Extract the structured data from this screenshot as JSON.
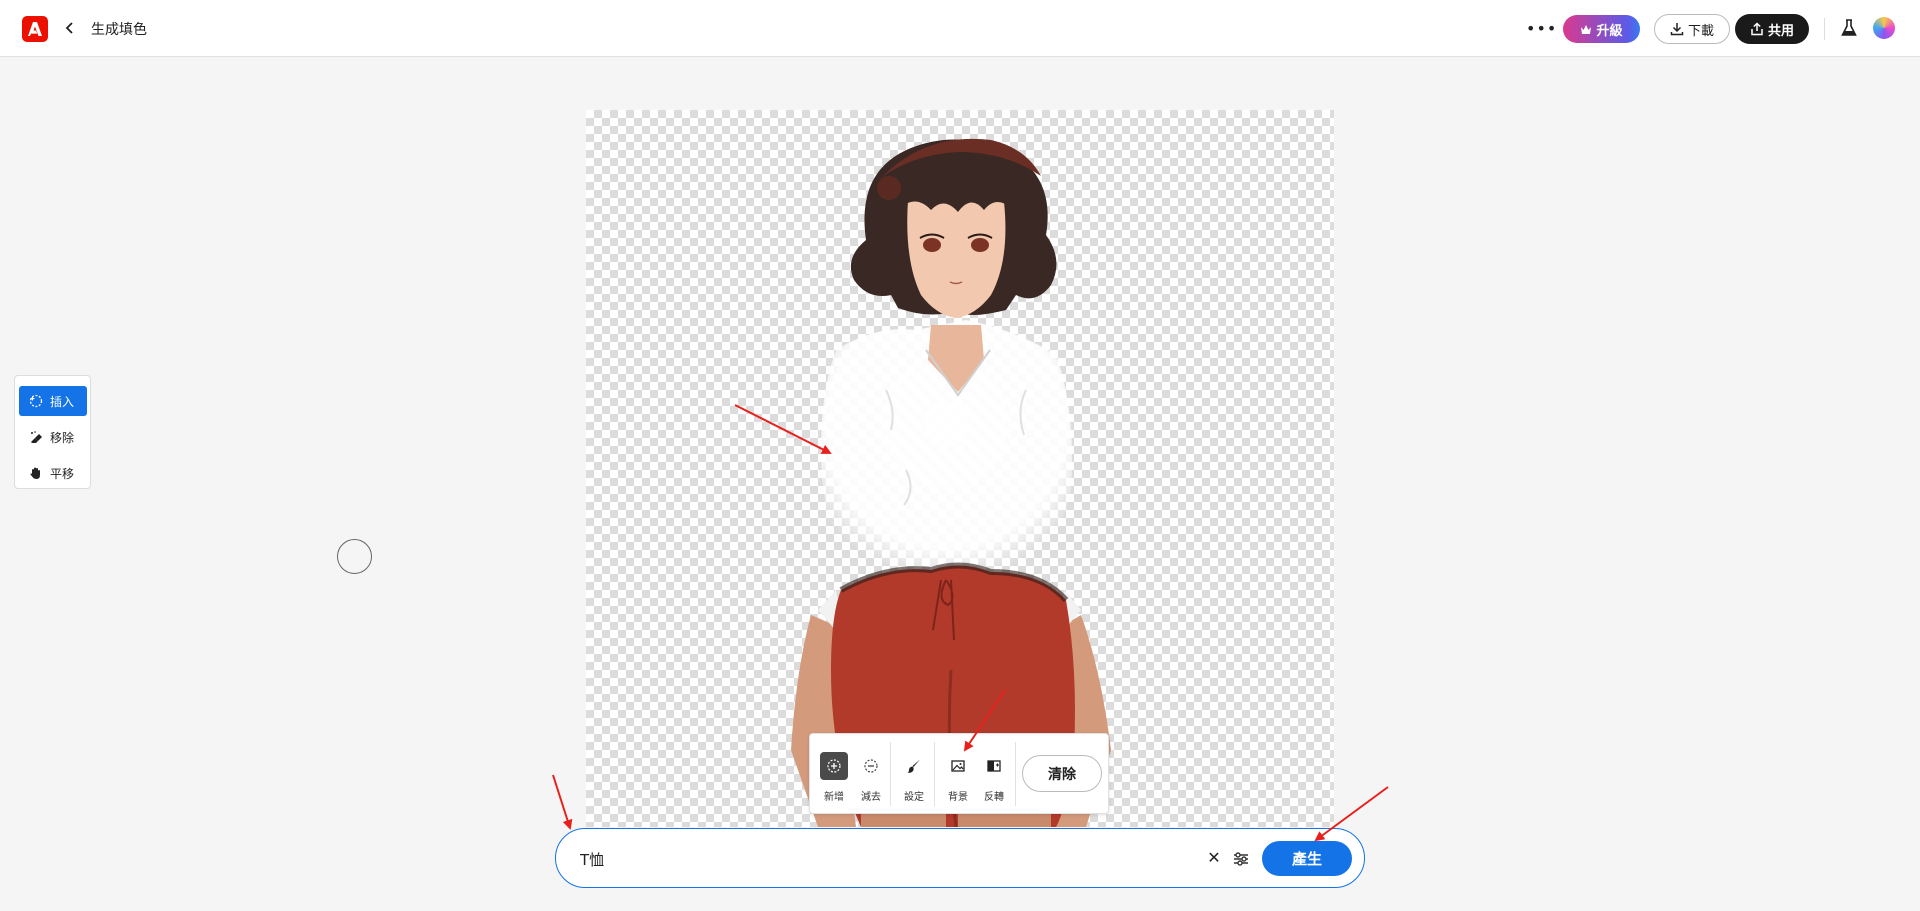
{
  "header": {
    "title": "生成填色",
    "upgrade_label": "升級",
    "download_label": "下載",
    "share_label": "共用"
  },
  "tools": {
    "items": [
      {
        "label": "插入",
        "icon": "insert-sparkle-icon",
        "active": true
      },
      {
        "label": "移除",
        "icon": "remove-eraser-icon",
        "active": false
      },
      {
        "label": "平移",
        "icon": "pan-hand-icon",
        "active": false
      }
    ]
  },
  "selection_toolbar": {
    "add_label": "新增",
    "subtract_label": "減去",
    "settings_label": "設定",
    "background_label": "背景",
    "invert_label": "反轉",
    "clear_label": "清除"
  },
  "prompt": {
    "value": "T恤",
    "generate_label": "產生"
  },
  "colors": {
    "accent": "#1473e6",
    "adobe_red": "#eb1000",
    "annotation_arrow": "#e8201b"
  }
}
